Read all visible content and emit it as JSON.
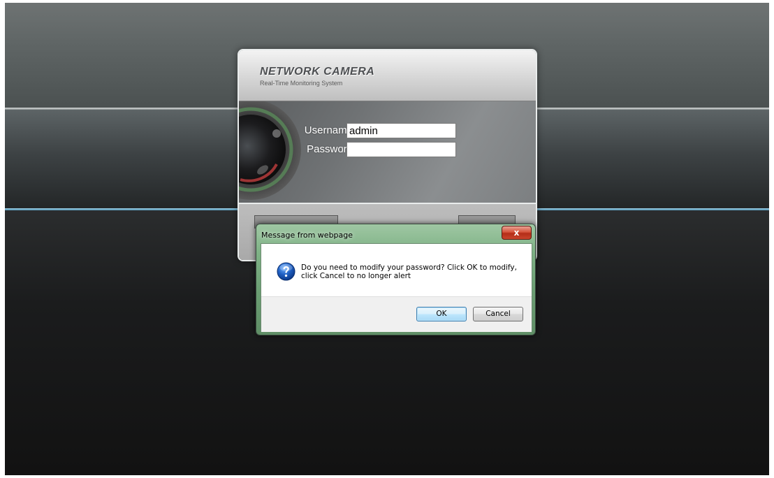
{
  "login": {
    "brand_title": "NETWORK CAMERA",
    "brand_subtitle": "Real-Time Monitoring System",
    "username_label": "Username",
    "username_value": "admin",
    "password_label": "Password",
    "password_value": "",
    "colon": ":"
  },
  "dialog": {
    "title": "Message from webpage",
    "close_glyph": "x",
    "icon": "question-icon",
    "message": "Do you need to modify your password? Click OK to modify, click Cancel to no longer alert",
    "ok_label": "OK",
    "cancel_label": "Cancel"
  },
  "colors": {
    "background_top": "#5f6565",
    "divider_accent": "#9fd3ea",
    "dialog_frame": "#7fb286",
    "close_button": "#c9452c"
  }
}
